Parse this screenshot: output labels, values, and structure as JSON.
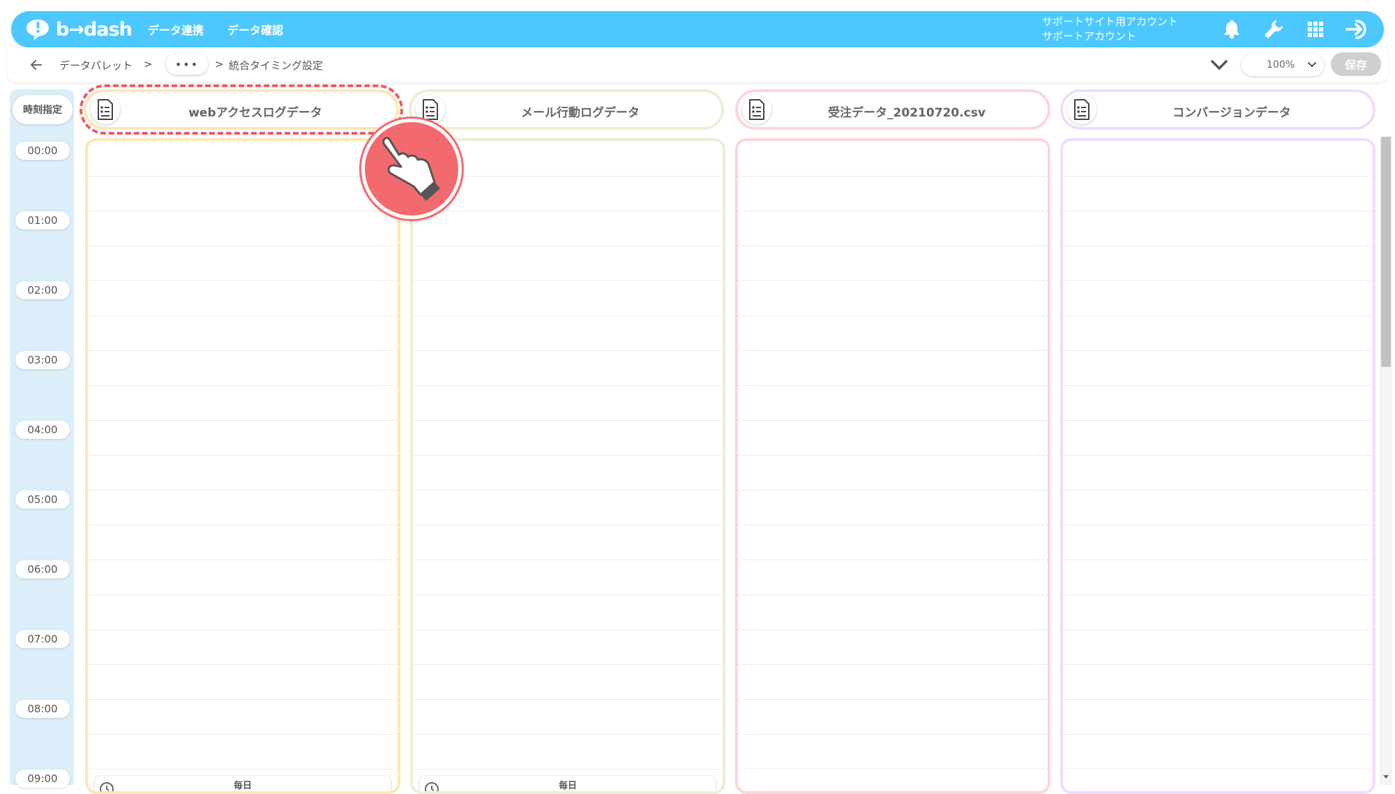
{
  "app": {
    "brand": "b→dash",
    "nav": [
      "データ連携",
      "データ確認"
    ],
    "account_line1": "サポートサイト用アカウント",
    "account_line2": "サポートアカウント",
    "icons": [
      "bell-icon",
      "wrench-icon",
      "grid-icon",
      "logout-icon"
    ]
  },
  "breadcrumb": {
    "root": "データパレット",
    "sep1": ">",
    "more": "•••",
    "sep2": ">",
    "current": "統合タイミング設定"
  },
  "toolbar": {
    "zoom": "100%",
    "save_label": "保存"
  },
  "timeline": {
    "header": "時刻指定",
    "times": [
      "00:00",
      "01:00",
      "02:00",
      "03:00",
      "04:00",
      "05:00",
      "06:00",
      "07:00",
      "08:00",
      "09:00"
    ]
  },
  "columns": [
    {
      "title": "webアクセスログデータ",
      "color": "#fbe8b6",
      "schedule": "毎日"
    },
    {
      "title": "メール行動ログデータ",
      "color": "#ecefd6",
      "schedule": "毎日"
    },
    {
      "title": "受注データ_20210720.csv",
      "color": "#fbd6d8",
      "schedule": ""
    },
    {
      "title": "コンバージョンデータ",
      "color": "#f0dcfb",
      "schedule": ""
    }
  ],
  "colors": {
    "header_bg": "#4dc8ff",
    "highlight": "#f05a64",
    "timeline_bg": "#dbeefa",
    "save_disabled": "#cfcfcf"
  }
}
